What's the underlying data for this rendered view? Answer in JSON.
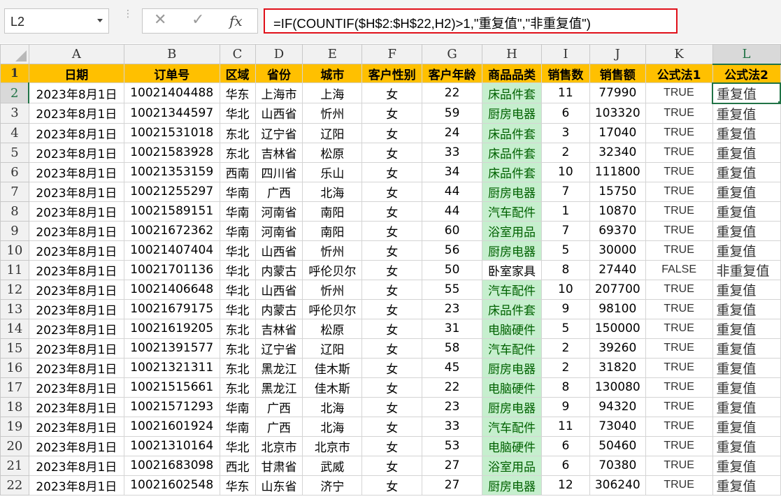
{
  "formula_bar": {
    "name_box": "L2",
    "fx_label": "fx",
    "formula": "=IF(COUNTIF($H$2:$H$22,H2)>1,\"重复值\",\"非重复值\")"
  },
  "columns": [
    "A",
    "B",
    "C",
    "D",
    "E",
    "F",
    "G",
    "H",
    "I",
    "J",
    "K",
    "L"
  ],
  "row_numbers": [
    "1",
    "2",
    "3",
    "4",
    "5",
    "6",
    "7",
    "8",
    "9",
    "10",
    "11",
    "12",
    "13",
    "14",
    "15",
    "16",
    "17",
    "18",
    "19",
    "20",
    "21",
    "22"
  ],
  "header": [
    "日期",
    "订单号",
    "区域",
    "省份",
    "城市",
    "客户性别",
    "客户年龄",
    "商品品类",
    "销售数",
    "销售额",
    "公式法1",
    "公式法2"
  ],
  "rows": [
    [
      "2023年8月1日",
      "10021404488",
      "华东",
      "上海市",
      "上海",
      "女",
      "22",
      "床品件套",
      "11",
      "77990",
      "TRUE",
      "重复值"
    ],
    [
      "2023年8月1日",
      "10021344597",
      "华北",
      "山西省",
      "忻州",
      "女",
      "59",
      "厨房电器",
      "6",
      "103320",
      "TRUE",
      "重复值"
    ],
    [
      "2023年8月1日",
      "10021531018",
      "东北",
      "辽宁省",
      "辽阳",
      "女",
      "24",
      "床品件套",
      "3",
      "17040",
      "TRUE",
      "重复值"
    ],
    [
      "2023年8月1日",
      "10021583928",
      "东北",
      "吉林省",
      "松原",
      "女",
      "33",
      "床品件套",
      "2",
      "32340",
      "TRUE",
      "重复值"
    ],
    [
      "2023年8月1日",
      "10021353159",
      "西南",
      "四川省",
      "乐山",
      "女",
      "34",
      "床品件套",
      "10",
      "111800",
      "TRUE",
      "重复值"
    ],
    [
      "2023年8月1日",
      "10021255297",
      "华南",
      "广西",
      "北海",
      "女",
      "44",
      "厨房电器",
      "7",
      "15750",
      "TRUE",
      "重复值"
    ],
    [
      "2023年8月1日",
      "10021589151",
      "华南",
      "河南省",
      "南阳",
      "女",
      "44",
      "汽车配件",
      "1",
      "10870",
      "TRUE",
      "重复值"
    ],
    [
      "2023年8月1日",
      "10021672362",
      "华南",
      "河南省",
      "南阳",
      "女",
      "60",
      "浴室用品",
      "7",
      "69370",
      "TRUE",
      "重复值"
    ],
    [
      "2023年8月1日",
      "10021407404",
      "华北",
      "山西省",
      "忻州",
      "女",
      "56",
      "厨房电器",
      "5",
      "30000",
      "TRUE",
      "重复值"
    ],
    [
      "2023年8月1日",
      "10021701136",
      "华北",
      "内蒙古",
      "呼伦贝尔",
      "女",
      "50",
      "卧室家具",
      "8",
      "27440",
      "FALSE",
      "非重复值"
    ],
    [
      "2023年8月1日",
      "10021406648",
      "华北",
      "山西省",
      "忻州",
      "女",
      "55",
      "汽车配件",
      "10",
      "207700",
      "TRUE",
      "重复值"
    ],
    [
      "2023年8月1日",
      "10021679175",
      "华北",
      "内蒙古",
      "呼伦贝尔",
      "女",
      "23",
      "床品件套",
      "9",
      "98100",
      "TRUE",
      "重复值"
    ],
    [
      "2023年8月1日",
      "10021619205",
      "东北",
      "吉林省",
      "松原",
      "女",
      "31",
      "电脑硬件",
      "5",
      "150000",
      "TRUE",
      "重复值"
    ],
    [
      "2023年8月1日",
      "10021391577",
      "东北",
      "辽宁省",
      "辽阳",
      "女",
      "58",
      "汽车配件",
      "2",
      "39260",
      "TRUE",
      "重复值"
    ],
    [
      "2023年8月1日",
      "10021321311",
      "东北",
      "黑龙江",
      "佳木斯",
      "女",
      "45",
      "厨房电器",
      "2",
      "31820",
      "TRUE",
      "重复值"
    ],
    [
      "2023年8月1日",
      "10021515661",
      "东北",
      "黑龙江",
      "佳木斯",
      "女",
      "22",
      "电脑硬件",
      "8",
      "130080",
      "TRUE",
      "重复值"
    ],
    [
      "2023年8月1日",
      "10021571293",
      "华南",
      "广西",
      "北海",
      "女",
      "23",
      "厨房电器",
      "9",
      "94320",
      "TRUE",
      "重复值"
    ],
    [
      "2023年8月1日",
      "10021601924",
      "华南",
      "广西",
      "北海",
      "女",
      "33",
      "汽车配件",
      "11",
      "73040",
      "TRUE",
      "重复值"
    ],
    [
      "2023年8月1日",
      "10021310164",
      "华北",
      "北京市",
      "北京市",
      "女",
      "53",
      "电脑硬件",
      "6",
      "50460",
      "TRUE",
      "重复值"
    ],
    [
      "2023年8月1日",
      "10021683098",
      "西北",
      "甘肃省",
      "武威",
      "女",
      "27",
      "浴室用品",
      "6",
      "70380",
      "TRUE",
      "重复值"
    ],
    [
      "2023年8月1日",
      "10021602548",
      "华东",
      "山东省",
      "济宁",
      "女",
      "27",
      "厨房电器",
      "12",
      "306240",
      "TRUE",
      "重复值"
    ]
  ],
  "highlight_colors": {
    "header_fill": "#ffc000",
    "duplicate_fill": "#c6efce",
    "duplicate_text": "#006100",
    "selection": "#217346",
    "formula_border": "#e0101a"
  }
}
